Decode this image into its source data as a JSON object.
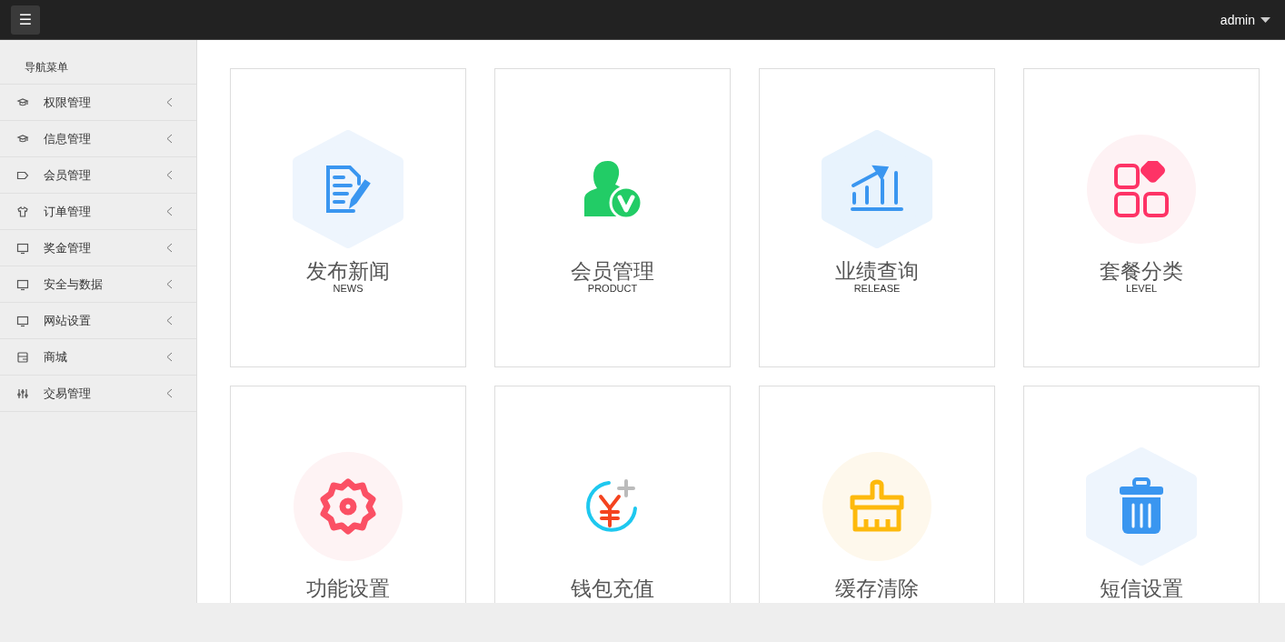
{
  "topbar": {
    "menu_button": "☰",
    "user": "admin"
  },
  "sidebar": {
    "title": "导航菜单",
    "items": [
      {
        "label": "权限管理",
        "kind": "cap",
        "expanded": false
      },
      {
        "label": "信息管理",
        "kind": "cap",
        "expanded": false
      },
      {
        "label": "会员管理",
        "kind": "tag",
        "expanded": false
      },
      {
        "label": "订单管理",
        "kind": "shirt",
        "expanded": false
      },
      {
        "label": "奖金管理",
        "kind": "monitor",
        "expanded": false
      },
      {
        "label": "安全与数据",
        "kind": "monitor",
        "expanded": false
      },
      {
        "label": "网站设置",
        "kind": "monitor",
        "expanded": false
      },
      {
        "label": "商城",
        "kind": "wallet",
        "expanded": false
      },
      {
        "label": "交易管理",
        "kind": "sliders",
        "expanded": false
      }
    ]
  },
  "cards": [
    {
      "title": "发布新闻",
      "subtitle": "NEWS",
      "kind": "document"
    },
    {
      "title": "会员管理",
      "subtitle": "PRODUCT",
      "kind": "user"
    },
    {
      "title": "业绩查询",
      "subtitle": "RELEASE",
      "kind": "chart"
    },
    {
      "title": "套餐分类",
      "subtitle": "LEVEL",
      "kind": "apps"
    },
    {
      "title": "功能设置",
      "kind": "gear"
    },
    {
      "title": "钱包充值",
      "kind": "yuan"
    },
    {
      "title": "缓存清除",
      "kind": "brush"
    },
    {
      "title": "短信设置",
      "kind": "trash"
    }
  ]
}
